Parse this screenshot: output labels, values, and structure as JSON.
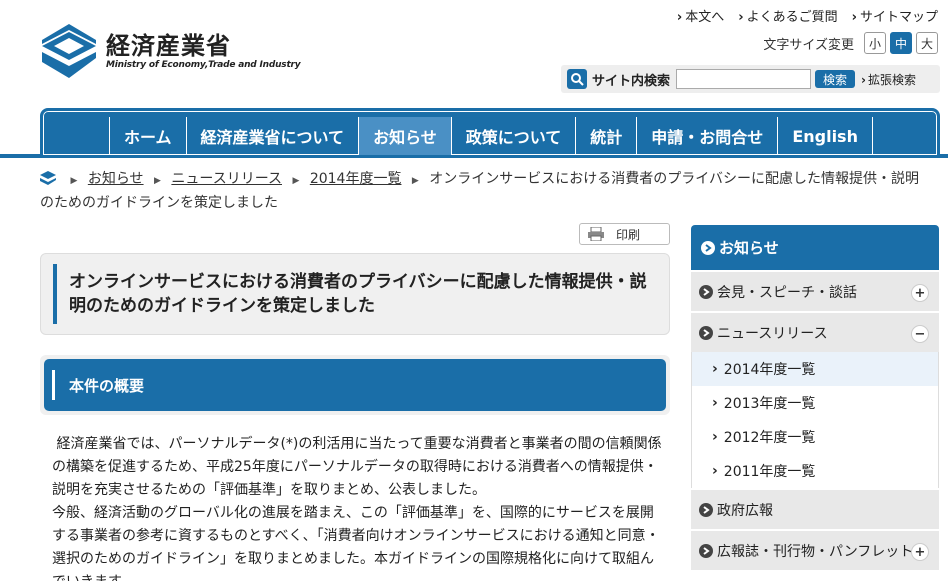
{
  "header": {
    "logo_jp": "経済産業省",
    "logo_en": "Ministry of Economy,Trade and Industry",
    "util_links": [
      "本文へ",
      "よくあるご質問",
      "サイトマップ"
    ],
    "font_size_label": "文字サイズ変更",
    "font_sizes": [
      "小",
      "中",
      "大"
    ],
    "search_label": "サイト内検索",
    "search_value": "",
    "search_button": "検索",
    "advanced_search": "拡張検索"
  },
  "nav": {
    "items": [
      "ホーム",
      "経済産業省について",
      "お知らせ",
      "政策について",
      "統計",
      "申請・お問合せ",
      "English"
    ],
    "active": "お知らせ"
  },
  "breadcrumb": {
    "links": [
      "お知らせ",
      "ニュースリリース",
      "2014年度一覧"
    ],
    "current": "オンラインサービスにおける消費者のプライバシーに配慮した情報提供・説明のためのガイドラインを策定しました"
  },
  "print_label": "印刷",
  "page_title": "オンラインサービスにおける消費者のプライバシーに配慮した情報提供・説明のためのガイドラインを策定しました",
  "section_title": "本件の概要",
  "body": {
    "p1": "経済産業省では、パーソナルデータ(*)の利活用に当たって重要な消費者と事業者の間の信頼関係の構築を促進するため、平成25年度にパーソナルデータの取得時における消費者への情報提供・説明を充実させるための「評価基準」を取りまとめ、公表しました。",
    "p2": "今般、経済活動のグローバル化の進展を踏まえ、この「評価基準」を、国際的にサービスを展開する事業者の参考に資するものとすべく、「消費者向けオンラインサービスにおける通知と同意・選択のためのガイドライン」を取りまとめました。本ガイドラインの国際規格化に向けて取組んでいきます。"
  },
  "sidebar": {
    "head": "お知らせ",
    "cat1": "会見・スピーチ・談話",
    "cat2": "ニュースリリース",
    "subs": [
      "2014年度一覧",
      "2013年度一覧",
      "2012年度一覧",
      "2011年度一覧"
    ],
    "cat3": "政府広報",
    "cat4": "広報誌・刊行物・パンフレット",
    "toggle_plus": "+",
    "toggle_minus": "−"
  },
  "colors": {
    "brand": "#1a6ea8",
    "nav_active": "#4a90c5"
  }
}
